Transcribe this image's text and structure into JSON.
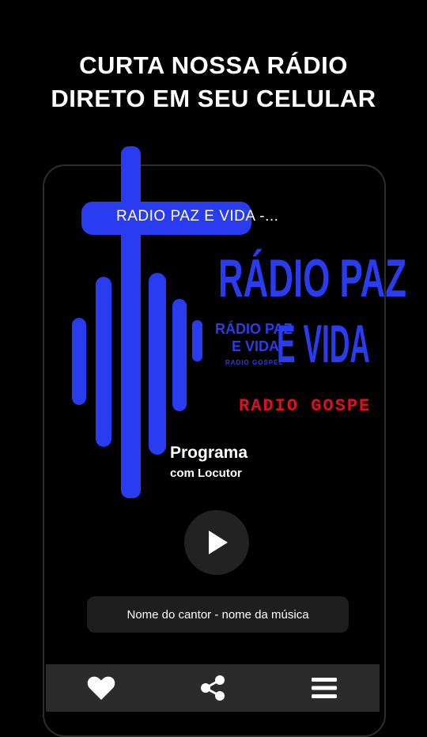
{
  "headline": {
    "line1": "CURTA NOSSA RÁDIO",
    "line2": "DIRETO EM SEU CELULAR"
  },
  "station": {
    "title": "RADIO PAZ E VIDA -...",
    "logo_line1": "RÁDIO PAZ",
    "logo_line2": "E VIDA",
    "logo_small1": "RÁDIO PAZ",
    "logo_small2": "E VIDA",
    "logo_tiny": "RADIO GOSPEL",
    "logo_tagline": "RADIO GOSPE",
    "logo_color": "#2a3cf0",
    "tagline_color": "#e0101a"
  },
  "program": {
    "title": "Programa",
    "subtitle": "com Locutor"
  },
  "player": {
    "now_playing": "Nome do cantor - nome da música",
    "play_icon": "play-icon"
  },
  "nav": {
    "items": [
      {
        "icon": "heart-icon"
      },
      {
        "icon": "share-icon"
      },
      {
        "icon": "menu-icon"
      }
    ]
  }
}
